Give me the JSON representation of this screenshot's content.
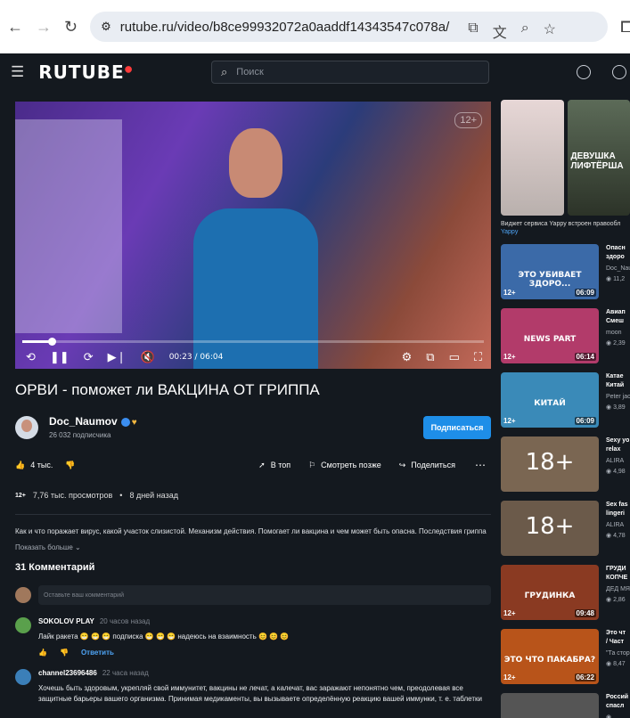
{
  "browser": {
    "url": "rutube.ru/video/b8ce99932072a0aaddf14343547c078a/"
  },
  "app": {
    "logo": "RUTUBE",
    "search_placeholder": "Поиск"
  },
  "player": {
    "age_badge": "12+",
    "time": "00:23 / 06:04",
    "progress_fraction": 0.063
  },
  "video": {
    "title": "ОРВИ - поможет ли ВАКЦИНА ОТ ГРИППА",
    "channel": "Doc_Naumov",
    "subscribers": "26 032 подписчика",
    "subscribe_label": "Подписаться",
    "likes": "4 тыс.",
    "to_top": "В топ",
    "watch_later": "Смотреть позже",
    "share": "Поделиться",
    "age": "12+",
    "views": "7,76 тыс. просмотров",
    "posted": "8 дней назад",
    "description": "Как и что поражает вирус, какой участок слизистой. Механизм действия. Помогает ли вакцина и чем может быть опасна. Последствия гриппа",
    "show_more": "Показать больше"
  },
  "comments": {
    "count_label": "31 Комментарий",
    "input_placeholder": "Оставьте ваш комментарий",
    "items": [
      {
        "author": "SOKOLOV PLAY",
        "time": "20 часов назад",
        "text": "Лайк ракета 😁 😁 😁 подписка 😁 😁 😁  надеюсь на взаимность 😊 😊 😊",
        "reply": "Ответить"
      },
      {
        "author": "channel23696486",
        "time": "22 часа назад",
        "text": "Хочешь быть здоровым, укрепляй свой иммунитет,  вакцины не лечат, а калечат, вас заражают непонятно чем, преодолевая все защитные барьеры вашего организма. Принимая медикаменты, вы вызываете определённую реакцию вашей иммунки, т. е. таблетки"
      }
    ]
  },
  "sidebar": {
    "yappy_text": "Виджет сервиса Yappy встроен правообл",
    "yappy_link": "Yappy",
    "yappy_label": "ДЕВУШКА ЛИФТЁРША",
    "recommendations": [
      {
        "thumb_text": "ЭТО УБИВАЕТ ЗДОРО...",
        "title": "Опасн",
        "title2": "здоро",
        "channel": "Doc_Nau",
        "views": "11,2",
        "age": "12+",
        "duration": "06:09",
        "color": "#3b6aa8"
      },
      {
        "thumb_text": "NEWS PART",
        "title": "Авиап",
        "title2": "Смеш",
        "channel": "moon",
        "views": "2,39",
        "age": "12+",
        "duration": "06:14",
        "color": "#b23b6a"
      },
      {
        "thumb_text": "КИТАЙ",
        "title": "Катае",
        "title2": "Китай",
        "channel": "Peter jac",
        "views": "3,89",
        "age": "12+",
        "duration": "06:09",
        "color": "#3a8ab8"
      },
      {
        "thumb_text": "18+",
        "title": "Sexy yo",
        "title2": "relax",
        "channel": "ALIRA",
        "views": "4,98",
        "age": "",
        "duration": "",
        "color": "#7a6652"
      },
      {
        "thumb_text": "18+",
        "title": "Sex fas",
        "title2": "lingeri",
        "channel": "ALIRA",
        "views": "4,78",
        "age": "",
        "duration": "",
        "color": "#6b5a4a"
      },
      {
        "thumb_text": "ГРУДИНКА",
        "title": "ГРУДИ",
        "title2": "КОПЧЕ",
        "channel": "ДЕД МЯС",
        "views": "2,86",
        "age": "12+",
        "duration": "09:48",
        "color": "#8a3a22"
      },
      {
        "thumb_text": "ЭТО ЧТО ПАКАБРА?",
        "title": "Это чт",
        "title2": "/ Част",
        "channel": "\"Та стор",
        "views": "8,47",
        "age": "12+",
        "duration": "06:22",
        "color": "#b8541a"
      },
      {
        "thumb_text": "",
        "title": "Россий",
        "title2": "спасл",
        "channel": "",
        "views": "",
        "age": "",
        "duration": "",
        "color": "#555"
      }
    ]
  }
}
